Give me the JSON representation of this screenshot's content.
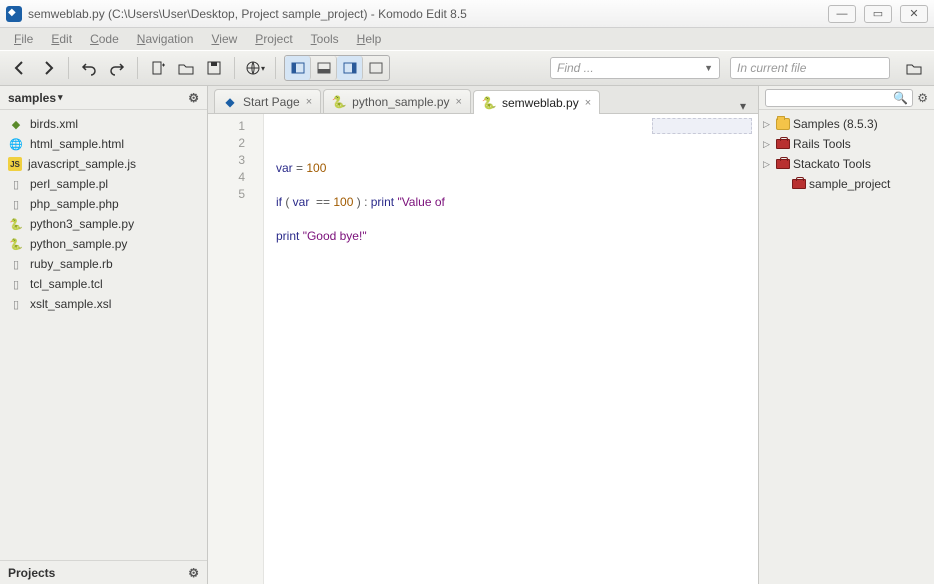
{
  "window": {
    "title": "semweblab.py (C:\\Users\\User\\Desktop, Project sample_project) - Komodo Edit 8.5"
  },
  "menu": {
    "items": [
      "File",
      "Edit",
      "Code",
      "Navigation",
      "View",
      "Project",
      "Tools",
      "Help"
    ]
  },
  "toolbar": {
    "find_placeholder": "Find ...",
    "scope_placeholder": "In current file"
  },
  "left_panel": {
    "header": "samples",
    "footer": "Projects",
    "files": [
      {
        "name": "birds.xml",
        "icon": "xml"
      },
      {
        "name": "html_sample.html",
        "icon": "html"
      },
      {
        "name": "javascript_sample.js",
        "icon": "js"
      },
      {
        "name": "perl_sample.pl",
        "icon": "file"
      },
      {
        "name": "php_sample.php",
        "icon": "file"
      },
      {
        "name": "python3_sample.py",
        "icon": "py"
      },
      {
        "name": "python_sample.py",
        "icon": "py"
      },
      {
        "name": "ruby_sample.rb",
        "icon": "file"
      },
      {
        "name": "tcl_sample.tcl",
        "icon": "file"
      },
      {
        "name": "xslt_sample.xsl",
        "icon": "file"
      }
    ]
  },
  "tabs": [
    {
      "label": "Start Page",
      "icon": "start",
      "active": false
    },
    {
      "label": "python_sample.py",
      "icon": "py",
      "active": false
    },
    {
      "label": "semweblab.py",
      "icon": "py",
      "active": true
    }
  ],
  "editor": {
    "line_numbers": [
      "1",
      "2",
      "3",
      "4",
      "5"
    ],
    "lines": [
      {
        "tokens": [
          {
            "t": "var",
            "c": "kw"
          },
          {
            "t": " = ",
            "c": "op"
          },
          {
            "t": "100",
            "c": "num"
          }
        ]
      },
      {
        "tokens": []
      },
      {
        "tokens": [
          {
            "t": "if",
            "c": "kw"
          },
          {
            "t": " ( ",
            "c": "op"
          },
          {
            "t": "var",
            "c": "kw"
          },
          {
            "t": "  == ",
            "c": "op"
          },
          {
            "t": "100",
            "c": "num"
          },
          {
            "t": " ) : ",
            "c": "op"
          },
          {
            "t": "print",
            "c": "kw"
          },
          {
            "t": " ",
            "c": ""
          },
          {
            "t": "\"Value of",
            "c": "str"
          }
        ]
      },
      {
        "tokens": []
      },
      {
        "tokens": [
          {
            "t": "print",
            "c": "kw"
          },
          {
            "t": " ",
            "c": ""
          },
          {
            "t": "\"Good bye!\"",
            "c": "str"
          }
        ]
      }
    ]
  },
  "right_panel": {
    "items": [
      {
        "label": "Samples (8.5.3)",
        "icon": "folder",
        "expandable": true,
        "indent": false
      },
      {
        "label": "Rails Tools",
        "icon": "toolbox",
        "expandable": true,
        "indent": false
      },
      {
        "label": "Stackato Tools",
        "icon": "toolbox",
        "expandable": true,
        "indent": false
      },
      {
        "label": "sample_project",
        "icon": "toolbox",
        "expandable": false,
        "indent": true
      }
    ]
  }
}
